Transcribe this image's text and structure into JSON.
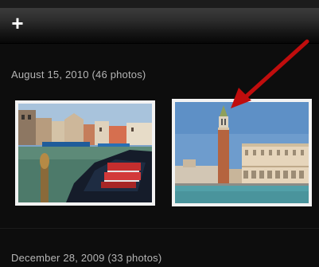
{
  "status_bar": {
    "text": ""
  },
  "toolbar": {
    "add_icon": "plus-icon",
    "add_glyph": "+"
  },
  "sections": [
    {
      "header": "August 15, 2010 (46 photos)"
    },
    {
      "header": "December 28, 2009 (33 photos)"
    }
  ],
  "photos": [
    {
      "name": "photo-venice-canal-boat",
      "subject": "canal-boat"
    },
    {
      "name": "photo-venice-campanile",
      "subject": "campanile-tower"
    }
  ],
  "annotation": {
    "arrow_color": "#c00d0d"
  }
}
